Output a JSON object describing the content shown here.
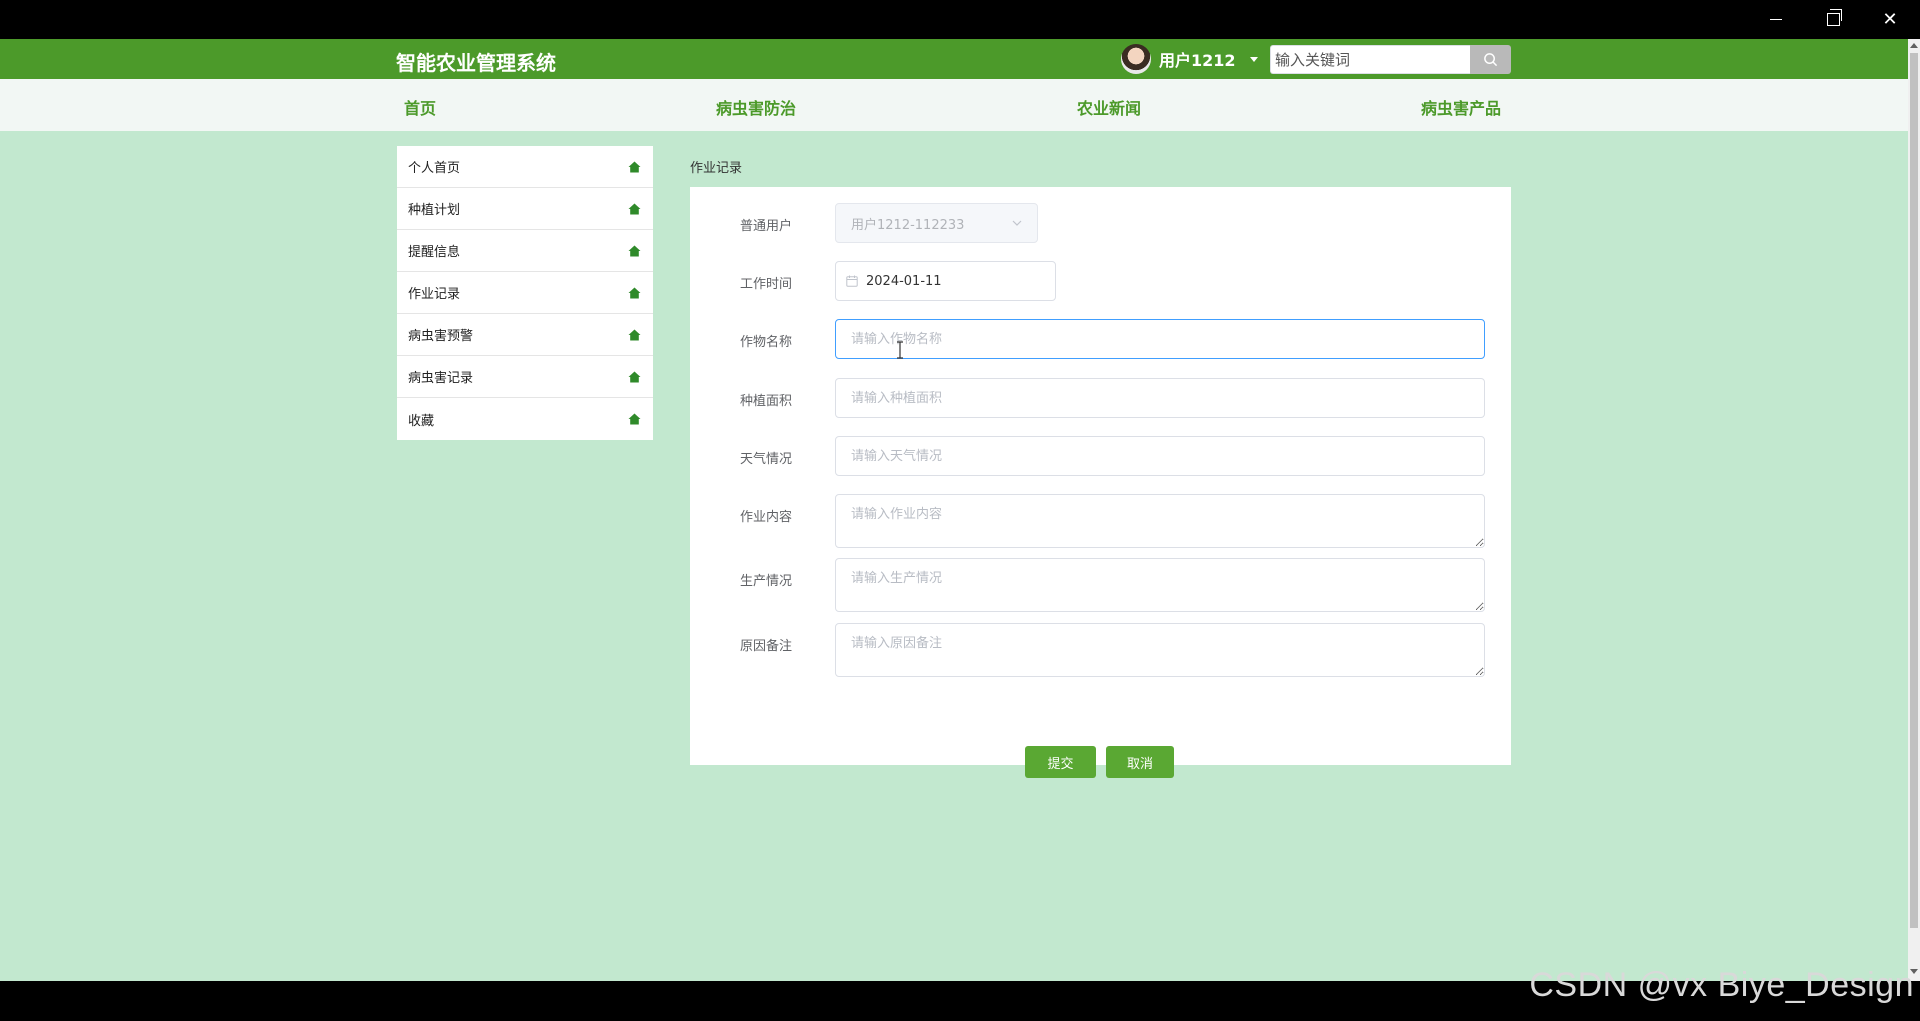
{
  "app": {
    "brand": "智能农业管理系统",
    "user_name": "用户1212",
    "search_placeholder": "输入关键词"
  },
  "nav": {
    "items": [
      "首页",
      "病虫害防治",
      "农业新闻",
      "病虫害产品"
    ]
  },
  "sidebar": {
    "items": [
      {
        "label": "个人首页",
        "icon": "home-icon"
      },
      {
        "label": "种植计划",
        "icon": "home-icon"
      },
      {
        "label": "提醒信息",
        "icon": "home-icon"
      },
      {
        "label": "作业记录",
        "icon": "home-icon"
      },
      {
        "label": "病虫害预警",
        "icon": "home-icon"
      },
      {
        "label": "病虫害记录",
        "icon": "home-icon"
      },
      {
        "label": "收藏",
        "icon": "home-icon"
      }
    ]
  },
  "content": {
    "breadcrumb": "作业记录",
    "form": {
      "user_label": "普通用户",
      "user_value": "用户1212-112233",
      "work_time_label": "工作时间",
      "work_time_value": "2024-01-11",
      "crop_name_label": "作物名称",
      "crop_name_placeholder": "请输入作物名称",
      "planting_area_label": "种植面积",
      "planting_area_placeholder": "请输入种植面积",
      "weather_label": "天气情况",
      "weather_placeholder": "请输入天气情况",
      "work_content_label": "作业内容",
      "work_content_placeholder": "请输入作业内容",
      "production_label": "生产情况",
      "production_placeholder": "请输入生产情况",
      "reason_label": "原因备注",
      "reason_placeholder": "请输入原因备注",
      "submit_label": "提交",
      "cancel_label": "取消"
    }
  },
  "watermark": "CSDN @vx Biye_Design",
  "colors": {
    "header_green": "#4c9a2a",
    "page_bg": "#c2e8cf",
    "button_green": "#5aa833",
    "focus_blue": "#409eff"
  }
}
